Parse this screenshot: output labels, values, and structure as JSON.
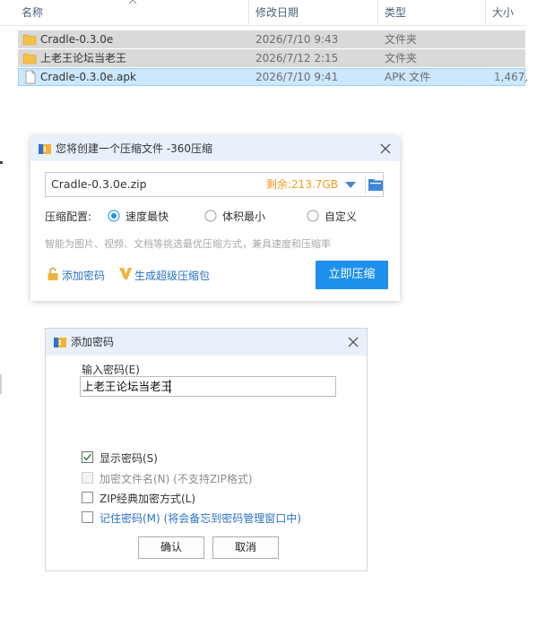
{
  "columns": {
    "name": "名称",
    "date": "修改日期",
    "type": "类型",
    "size": "大小"
  },
  "files": [
    {
      "name": "Cradle-0.3.0e",
      "date": "2026/7/10 9:43",
      "type": "文件夹",
      "size": ""
    },
    {
      "name": "上老王论坛当老王",
      "date": "2026/7/12 2:15",
      "type": "文件夹",
      "size": ""
    },
    {
      "name": "Cradle-0.3.0e.apk",
      "date": "2026/7/10 9:41",
      "type": "APK 文件",
      "size": "1,467,"
    }
  ],
  "compress_dialog": {
    "title": "您将创建一个压缩文件 -360压缩",
    "filename": "Cradle-0.3.0e.zip",
    "remaining": "剩余:213.7GB",
    "config_label": "压缩配置:",
    "options": [
      "速度最快",
      "体积最小",
      "自定义"
    ],
    "selected_option": "速度最快",
    "hint": "智能为图片、视频、文档等挑选最优压缩方式，兼具速度和压缩率",
    "add_password": "添加密码",
    "super_package": "生成超级压缩包",
    "compress_now": "立即压缩"
  },
  "password_dialog": {
    "title": "添加密码",
    "input_label": "输入密码(E)",
    "password_value": "上老王论坛当老王",
    "checkboxes": [
      {
        "label": "显示密码(S)",
        "checked": true,
        "disabled": false
      },
      {
        "label": "加密文件名(N) (不支持ZIP格式)",
        "checked": false,
        "disabled": true
      },
      {
        "label": "ZIP经典加密方式(L)",
        "checked": false,
        "disabled": false
      },
      {
        "label": "记住密码(M) (将会备忘到密码管理窗口中)",
        "checked": false,
        "disabled": false
      }
    ],
    "ok": "确认",
    "cancel": "取消"
  },
  "colors": {
    "accent": "#1e90ec",
    "link": "#2a73c4",
    "remaining": "#f39a1e",
    "title_bar": "#e8f1fb"
  }
}
